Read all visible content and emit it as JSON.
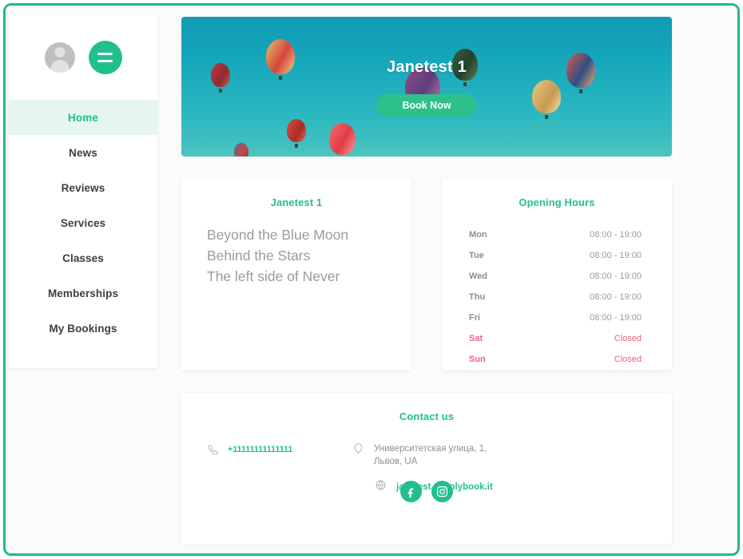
{
  "theme": {
    "accent": "#22bf8e",
    "frame_border": "#22b88a",
    "closed_color": "#f4607f",
    "page_bg": "#fbfbfb",
    "hero_sky": "#17a8bc"
  },
  "sidebar": {
    "avatar_name": "user-avatar",
    "menu_toggle_name": "hamburger-menu",
    "items": [
      {
        "label": "Home",
        "active": true
      },
      {
        "label": "News",
        "active": false
      },
      {
        "label": "Reviews",
        "active": false
      },
      {
        "label": "Services",
        "active": false
      },
      {
        "label": "Classes",
        "active": false
      },
      {
        "label": "Memberships",
        "active": false
      },
      {
        "label": "My Bookings",
        "active": false
      }
    ]
  },
  "hero": {
    "title": "Janetest 1",
    "cta_label": "Book Now",
    "image_subject": "hot-air-balloons-in-teal-sky"
  },
  "about_card": {
    "title": "Janetest 1",
    "lines": [
      "Beyond the Blue Moon",
      "Behind the Stars",
      "The left side of Never"
    ]
  },
  "opening_hours": {
    "title": "Opening Hours",
    "rows": [
      {
        "day": "Mon",
        "time": "08:00 - 19:00",
        "closed": false
      },
      {
        "day": "Tue",
        "time": "08:00 - 19:00",
        "closed": false
      },
      {
        "day": "Wed",
        "time": "08:00 - 19:00",
        "closed": false
      },
      {
        "day": "Thu",
        "time": "08:00 - 19:00",
        "closed": false
      },
      {
        "day": "Fri",
        "time": "08:00 - 19:00",
        "closed": false
      },
      {
        "day": "Sat",
        "time": "Closed",
        "closed": true
      },
      {
        "day": "Sun",
        "time": "Closed",
        "closed": true
      }
    ]
  },
  "contact": {
    "title": "Contact us",
    "phone": "+11111111111111",
    "address_line1": "Университетская улица, 1,",
    "address_line2": "Львов, UA",
    "website": "janetest.simplybook.it",
    "socials": [
      {
        "name": "facebook",
        "glyph": "f"
      },
      {
        "name": "instagram",
        "glyph": ""
      }
    ]
  }
}
